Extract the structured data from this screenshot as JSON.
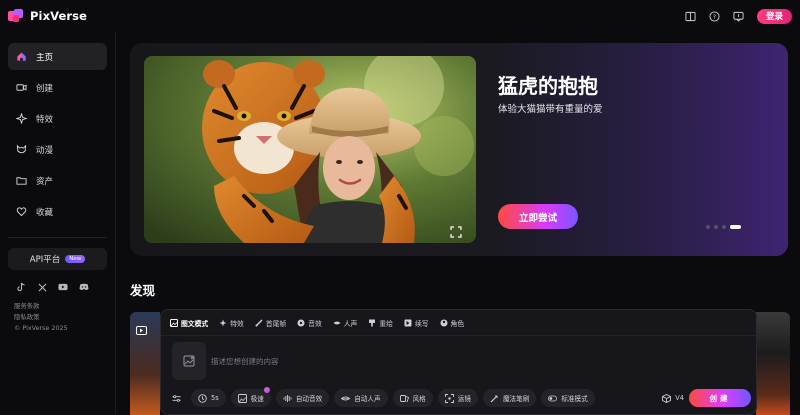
{
  "app": {
    "name": "PixVerse"
  },
  "topbar": {
    "login_label": "登录"
  },
  "sidebar": {
    "items": [
      {
        "label": "主页",
        "icon": "home-icon",
        "active": true
      },
      {
        "label": "创建",
        "icon": "video-camera-icon",
        "active": false
      },
      {
        "label": "特效",
        "icon": "sparkle-icon",
        "active": false
      },
      {
        "label": "动漫",
        "icon": "anime-mask-icon",
        "active": false
      },
      {
        "label": "资产",
        "icon": "folder-icon",
        "active": false
      },
      {
        "label": "收藏",
        "icon": "heart-icon",
        "active": false
      }
    ],
    "api_label": "API平台",
    "api_badge": "New",
    "socials": [
      "tiktok-icon",
      "x-icon",
      "youtube-icon",
      "discord-icon"
    ],
    "footer": {
      "terms": "服务条款",
      "privacy": "隐私政策",
      "copyright": "© PixVerse 2025"
    }
  },
  "banner": {
    "title": "猛虎的抱抱",
    "subtitle": "体验大猫猫带有重量的爱",
    "cta": "立即尝试",
    "slides": 4,
    "active_slide": 4
  },
  "discover": {
    "title": "发现"
  },
  "composer": {
    "tabs": [
      {
        "label": "图文模式",
        "icon": "image-icon",
        "active": true
      },
      {
        "label": "特效",
        "icon": "sparkle-icon",
        "active": false
      },
      {
        "label": "首尾帧",
        "icon": "frames-icon",
        "active": false
      },
      {
        "label": "音效",
        "icon": "music-icon",
        "active": false
      },
      {
        "label": "人声",
        "icon": "lips-icon",
        "active": false
      },
      {
        "label": "重绘",
        "icon": "brush-icon",
        "active": false
      },
      {
        "label": "续写",
        "icon": "continue-icon",
        "active": false
      },
      {
        "label": "角色",
        "icon": "character-icon",
        "active": false
      }
    ],
    "prompt_placeholder": "描述您想创建的内容",
    "tools": {
      "duration": "5s",
      "speed": "极速",
      "auto_sfx": "自动音效",
      "auto_voice": "自动人声",
      "style": "风格",
      "camera": "运镜",
      "magic_brush": "魔法笔刷",
      "mode": "标准模式"
    },
    "model": "V4",
    "create_label": "创建"
  },
  "colors": {
    "accent_pink": "#ff3d7a",
    "accent_purple": "#7a55ff",
    "accent_orange": "#ff4a3d"
  }
}
